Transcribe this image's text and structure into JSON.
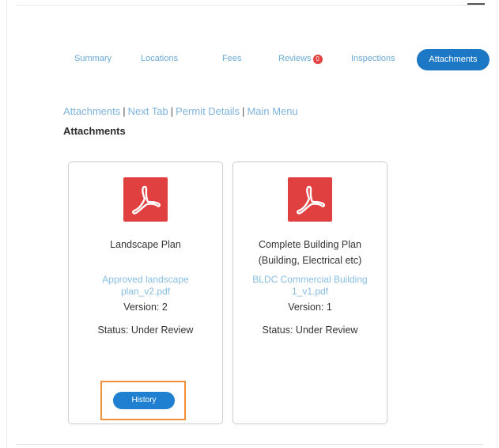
{
  "tabs": {
    "summary": "Summary",
    "locations": "Locations",
    "fees": "Fees",
    "reviews": "Reviews",
    "reviews_badge": "0",
    "inspections": "Inspections",
    "attachments": "Attachments"
  },
  "breadcrumb": {
    "attachments": "Attachments",
    "next_tab": "Next Tab",
    "permit_details": "Permit Details",
    "main_menu": "Main Menu",
    "separator": "|"
  },
  "page_title": "Attachments",
  "cards": [
    {
      "name": "Landscape Plan",
      "file_link": "Approved landscape plan_v2.pdf",
      "version": "Version: 2",
      "status": "Status: Under Review",
      "history_label": "History",
      "icon": "pdf-icon"
    },
    {
      "name_line1": "Complete Building Plan",
      "name_line2": "(Building, Electrical etc)",
      "file_link": "BLDC Commercial Building 1_v1.pdf",
      "version": "Version: 1",
      "status": "Status: Under Review",
      "icon": "pdf-icon"
    }
  ],
  "colors": {
    "accent": "#1c78c4",
    "link": "#7db3dc",
    "badge": "#e2433f",
    "pdf": "#e04040",
    "highlight": "#f0913a"
  }
}
